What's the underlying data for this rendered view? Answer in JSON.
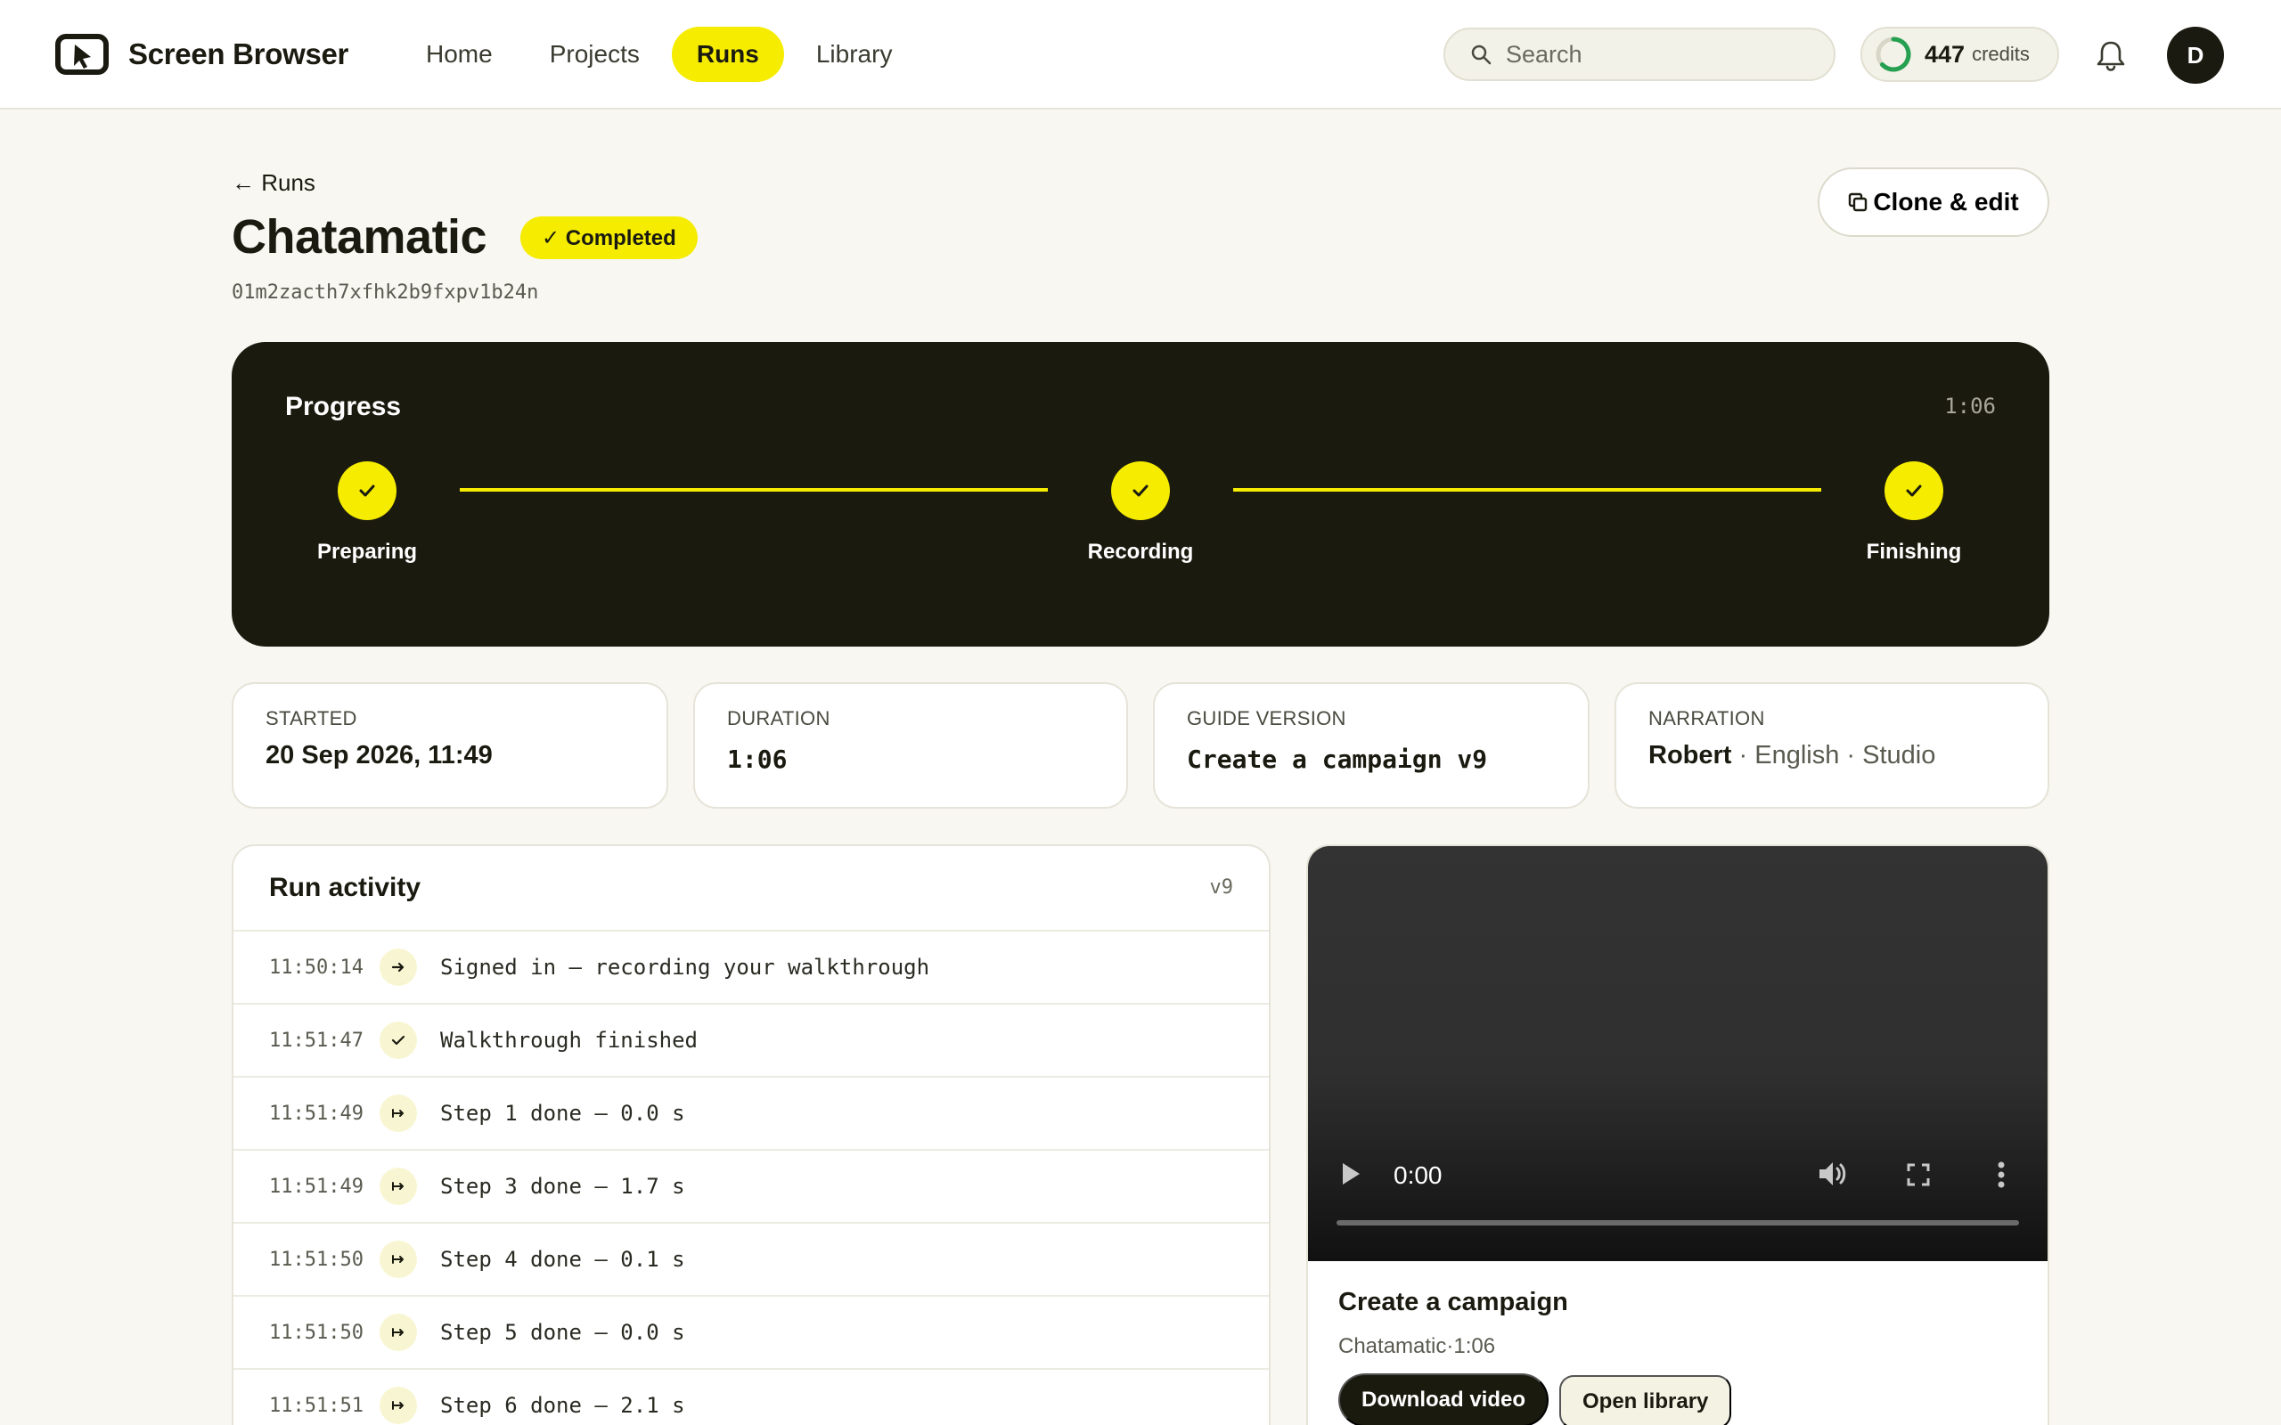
{
  "app": {
    "name": "Screen Browser",
    "nav": [
      {
        "label": "Home"
      },
      {
        "label": "Projects"
      },
      {
        "label": "Runs"
      },
      {
        "label": "Library"
      }
    ],
    "search_placeholder": "Search",
    "credits": {
      "count": "447",
      "label": "credits"
    },
    "avatar_initial": "D"
  },
  "run": {
    "back_label": "← Runs",
    "title": "Chatamatic",
    "status": "✓ Completed",
    "id": "01m2zacth7xfhk2b9fxpv1b24n",
    "clone_label": "Clone & edit"
  },
  "progress": {
    "title": "Progress",
    "elapsed": "1:06",
    "steps": [
      {
        "label": "Preparing",
        "state": "done"
      },
      {
        "label": "Recording",
        "state": "done"
      },
      {
        "label": "Finishing",
        "state": "done"
      }
    ]
  },
  "stats": {
    "started": {
      "label": "STARTED",
      "value": "20 Sep 2026, 11:49"
    },
    "duration": {
      "label": "DURATION",
      "value": "1:06"
    },
    "guide_version": {
      "label": "GUIDE VERSION",
      "value": "Create a campaign v9"
    },
    "narration": {
      "label": "NARRATION",
      "voice": "Robert",
      "language": "English",
      "quality": "Studio"
    }
  },
  "activity": {
    "title": "Run activity",
    "version": "v9",
    "rows": [
      {
        "time": "11:50:14",
        "icon": "arrow-right-icon",
        "text": "Signed in — recording your walkthrough"
      },
      {
        "time": "11:51:47",
        "icon": "check-icon",
        "text": "Walkthrough finished"
      },
      {
        "time": "11:51:49",
        "icon": "step-arrow-icon",
        "text": "Step 1 done — 0.0 s"
      },
      {
        "time": "11:51:49",
        "icon": "step-arrow-icon",
        "text": "Step 3 done — 1.7 s"
      },
      {
        "time": "11:51:50",
        "icon": "step-arrow-icon",
        "text": "Step 4 done — 0.1 s"
      },
      {
        "time": "11:51:50",
        "icon": "step-arrow-icon",
        "text": "Step 5 done — 0.0 s"
      },
      {
        "time": "11:51:51",
        "icon": "step-arrow-icon",
        "text": "Step 6 done — 2.1 s"
      }
    ]
  },
  "video": {
    "current_time": "0:00",
    "title": "Create a campaign",
    "project": "Chatamatic",
    "length": "1:06",
    "download_label": "Download video",
    "library_label": "Open library"
  },
  "colors": {
    "accent": "#f5ec00",
    "dark": "#1b1a0f",
    "background": "#f8f7f2"
  }
}
